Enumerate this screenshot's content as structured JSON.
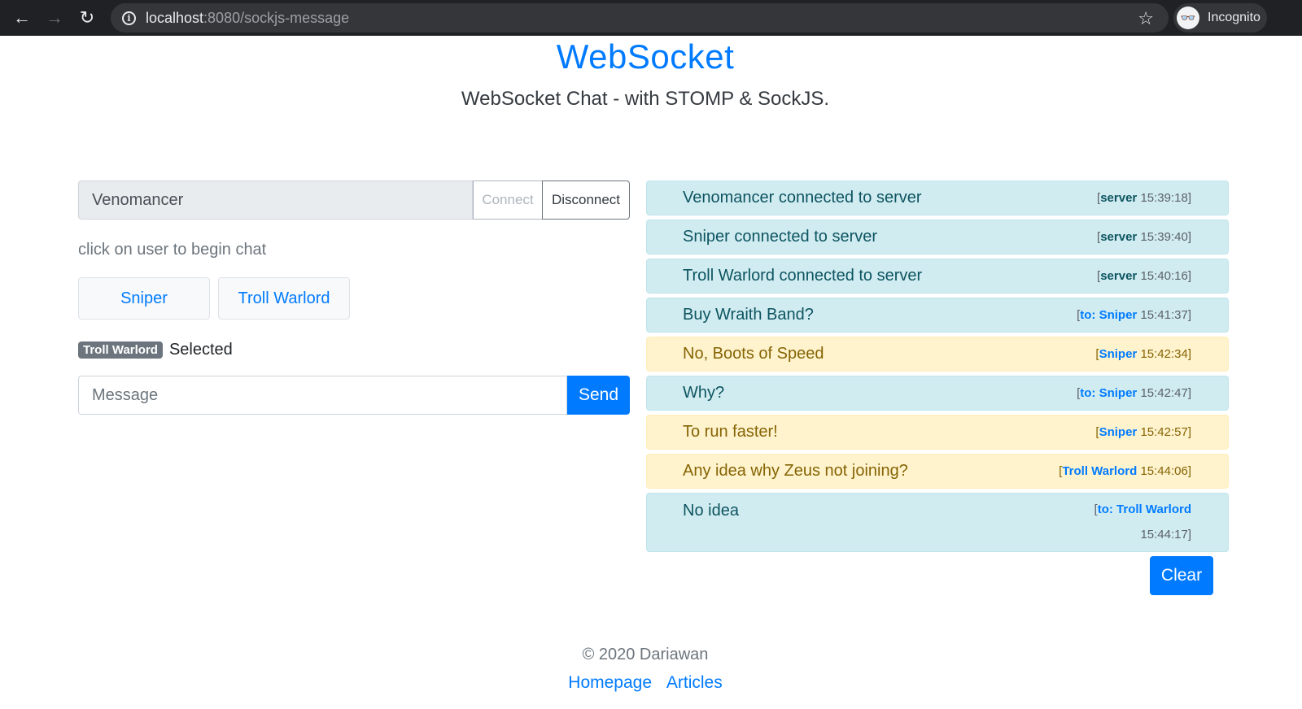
{
  "browser": {
    "url_host": "localhost",
    "url_rest": ":8080/sockjs-message",
    "profile_label": "Incognito",
    "icons": {
      "back": "arrow-left-icon",
      "forward": "arrow-right-icon",
      "reload": "reload-icon",
      "site_info": "info-icon",
      "bookmark": "star-icon",
      "profile": "incognito-icon"
    }
  },
  "header": {
    "title": "WebSocket",
    "subtitle": "WebSocket Chat - with STOMP & SockJS."
  },
  "connection": {
    "username_value": "Venomancer",
    "connect_label": "Connect",
    "disconnect_label": "Disconnect"
  },
  "users_panel": {
    "hint": "click on user to begin chat",
    "users": [
      "Sniper",
      "Troll Warlord"
    ],
    "selected_user": "Troll Warlord",
    "selected_suffix": "Selected"
  },
  "composer": {
    "placeholder": "Message",
    "value": "",
    "send_label": "Send"
  },
  "messages": [
    {
      "text": "Venomancer connected to server",
      "from": "server",
      "time": "15:39:18",
      "type": "info"
    },
    {
      "text": "Sniper connected to server",
      "from": "server",
      "time": "15:39:40",
      "type": "info"
    },
    {
      "text": "Troll Warlord connected to server",
      "from": "server",
      "time": "15:40:16",
      "type": "info"
    },
    {
      "text": "Buy Wraith Band?",
      "from": "to: Sniper",
      "time": "15:41:37",
      "type": "info"
    },
    {
      "text": "No, Boots of Speed",
      "from": "Sniper",
      "time": "15:42:34",
      "type": "warn"
    },
    {
      "text": "Why?",
      "from": "to: Sniper",
      "time": "15:42:47",
      "type": "info"
    },
    {
      "text": "To run faster!",
      "from": "Sniper",
      "time": "15:42:57",
      "type": "warn"
    },
    {
      "text": "Any idea why Zeus not joining?",
      "from": "Troll Warlord",
      "time": "15:44:06",
      "type": "warn"
    },
    {
      "text": "No idea",
      "from": "to: Troll Warlord",
      "time": "15:44:17",
      "type": "info"
    }
  ],
  "clear_label": "Clear",
  "footer": {
    "copyright": "© 2020 Dariawan",
    "links": [
      "Homepage",
      "Articles"
    ]
  },
  "colors": {
    "primary": "#007bff",
    "info_bg": "#d1ecf1",
    "warning_bg": "#fff3cd",
    "badge_bg": "#6c757d"
  }
}
